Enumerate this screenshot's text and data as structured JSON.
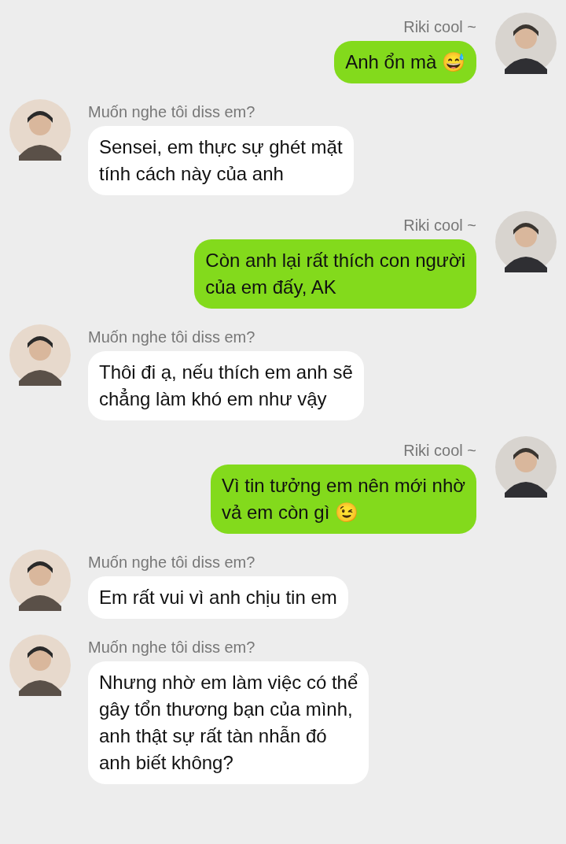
{
  "messages": [
    {
      "kind": "out",
      "sender": "Riki cool ~",
      "lines": [
        "Anh ổn mà 😅"
      ]
    },
    {
      "kind": "in",
      "sender": "Muốn nghe tôi diss em?",
      "lines": [
        "Sensei, em thực sự ghét mặt",
        "tính cách này của anh"
      ]
    },
    {
      "kind": "out",
      "sender": "Riki cool ~",
      "lines": [
        "Còn anh lại rất thích con người",
        "của em đấy, AK"
      ]
    },
    {
      "kind": "in",
      "sender": "Muốn nghe tôi diss em?",
      "lines": [
        "Thôi đi ạ, nếu thích em anh sẽ",
        "chẳng làm khó em như vậy"
      ]
    },
    {
      "kind": "out",
      "sender": "Riki cool ~",
      "lines": [
        "Vì tin tưởng em nên mới nhờ",
        "vả em còn gì 😉"
      ]
    },
    {
      "kind": "in",
      "sender": "Muốn nghe tôi diss em?",
      "lines": [
        "Em rất vui vì anh chịu tin em"
      ]
    },
    {
      "kind": "in",
      "sender": "Muốn nghe tôi diss em?",
      "lines": [
        "Nhưng nhờ em làm việc có thể",
        "gây tổn thương bạn của mình,",
        "anh thật sự rất tàn nhẫn đó",
        "anh biết không?"
      ]
    }
  ]
}
